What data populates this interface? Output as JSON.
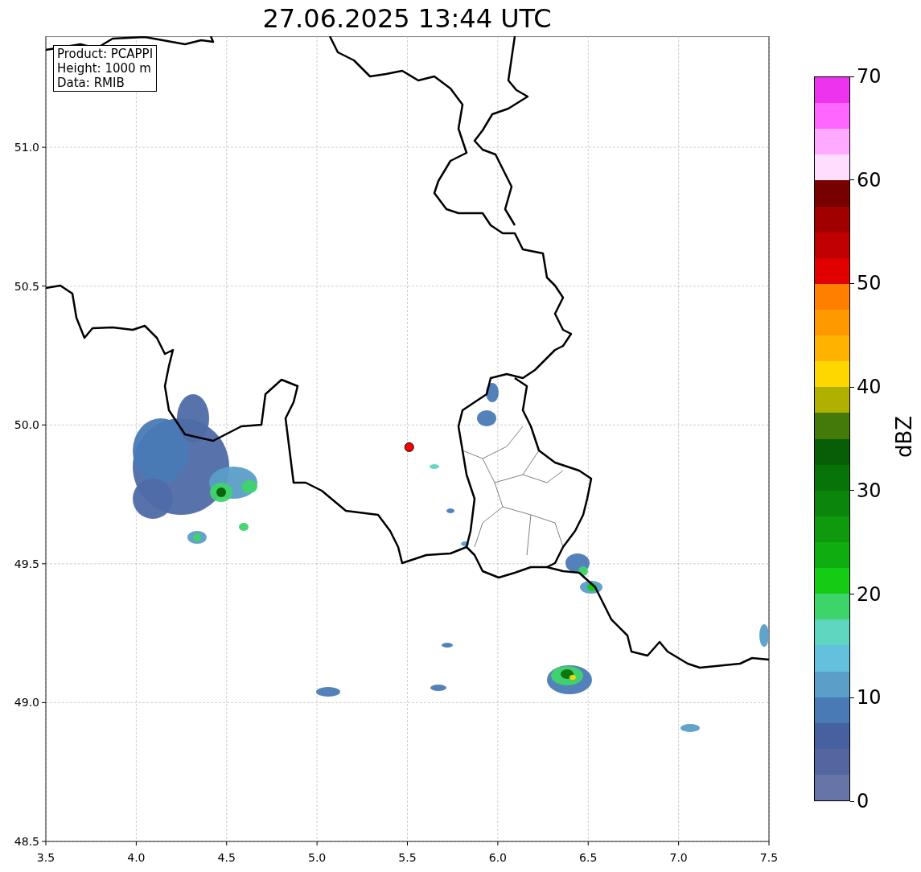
{
  "info_box": [
    "Product: PCAPPI",
    "Height: 1000 m",
    "Data: RMIB"
  ],
  "chart_data": {
    "type": "scatter",
    "grid": true,
    "title": "27.06.2025 13:44 UTC",
    "xlim": [
      3.5,
      7.5
    ],
    "ylim": [
      48.5,
      51.4
    ],
    "xticks": [
      {
        "value": 3.5,
        "label": "3.5"
      },
      {
        "value": 4.0,
        "label": "4.0"
      },
      {
        "value": 4.5,
        "label": "4.5"
      },
      {
        "value": 5.0,
        "label": "5.0"
      },
      {
        "value": 5.5,
        "label": "5.5"
      },
      {
        "value": 6.0,
        "label": "6.0"
      },
      {
        "value": 6.5,
        "label": "6.5"
      },
      {
        "value": 7.0,
        "label": "7.0"
      },
      {
        "value": 7.5,
        "label": "7.5"
      }
    ],
    "yticks": [
      {
        "value": 48.5,
        "label": "48.5"
      },
      {
        "value": 49.0,
        "label": "49.0"
      },
      {
        "value": 49.5,
        "label": "49.5"
      },
      {
        "value": 50.0,
        "label": "50.0"
      },
      {
        "value": 50.5,
        "label": "50.5"
      },
      {
        "value": 51.0,
        "label": "51.0"
      }
    ],
    "series": [
      {
        "color": "#ff0000",
        "x": [
          5.51
        ],
        "values": [
          49.92
        ]
      }
    ]
  },
  "colorbar": {
    "label": "dBZ",
    "ticks": [
      "70",
      "60",
      "50",
      "40",
      "30",
      "20",
      "10",
      "0"
    ],
    "segments": [
      {
        "color": "#ee33ee"
      },
      {
        "color": "#ff66ff"
      },
      {
        "color": "#ffaaff"
      },
      {
        "color": "#ffddff"
      },
      {
        "color": "#770000"
      },
      {
        "color": "#a00000"
      },
      {
        "color": "#c00000"
      },
      {
        "color": "#e00000"
      },
      {
        "color": "#ff7f00"
      },
      {
        "color": "#ff9900"
      },
      {
        "color": "#ffb300"
      },
      {
        "color": "#ffd700"
      },
      {
        "color": "#b0b000"
      },
      {
        "color": "#437a0a"
      },
      {
        "color": "#075e07"
      },
      {
        "color": "#087308"
      },
      {
        "color": "#0b860b"
      },
      {
        "color": "#0e990e"
      },
      {
        "color": "#10ad10"
      },
      {
        "color": "#14cc14"
      },
      {
        "color": "#3fd46a"
      },
      {
        "color": "#5ed6c0"
      },
      {
        "color": "#64c0dc"
      },
      {
        "color": "#5b9ec8"
      },
      {
        "color": "#4a7ab5"
      },
      {
        "color": "#4660a0"
      },
      {
        "color": "#5565a0"
      },
      {
        "color": "#6674a8"
      }
    ]
  }
}
